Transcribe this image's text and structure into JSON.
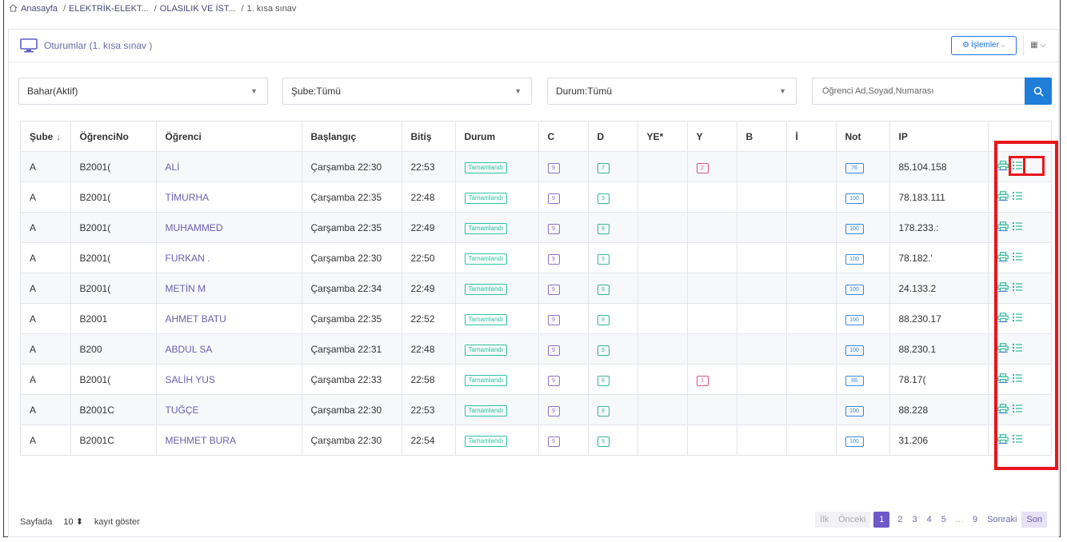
{
  "breadcrumb": {
    "home": "Anasayfa",
    "items": [
      "ELEKTRİK-ELEKT...",
      "OLASILIK VE İST...",
      "1. kısa sınav"
    ]
  },
  "header": {
    "title": "Oturumlar (1. kısa sınav )",
    "ops_label": "İşlemler"
  },
  "filters": {
    "term": "Bahar(Aktif)",
    "branch": "Şube:Tümü",
    "status": "Durum:Tümü",
    "search_placeholder": "Öğrenci Ad,Soyad,Numarası"
  },
  "table": {
    "columns": [
      "Şube",
      "ÖğrenciNo",
      "Öğrenci",
      "Başlangıç",
      "Bitiş",
      "Durum",
      "C",
      "D",
      "YE*",
      "Y",
      "B",
      "İ",
      "Not",
      "IP",
      ""
    ],
    "sort_indicator": "↓",
    "rows": [
      {
        "sube": "A",
        "no": "B2001(",
        "ogrenci": "ALİ",
        "baslangic": "Çarşamba 22:30",
        "bitis": "22:53",
        "durum": "Tamamlandı",
        "c": "9",
        "d": "7",
        "ye": "",
        "y": "2",
        "b": "",
        "i": "",
        "not": "76",
        "ip": "85.104.158"
      },
      {
        "sube": "A",
        "no": "B2001(",
        "ogrenci": "TİMURHA",
        "baslangic": "Çarşamba 22:35",
        "bitis": "22:48",
        "durum": "Tamamlandı",
        "c": "9",
        "d": "9",
        "ye": "",
        "y": "",
        "b": "",
        "i": "",
        "not": "100",
        "ip": "78.183.111"
      },
      {
        "sube": "A",
        "no": "B2001(",
        "ogrenci": "MUHAMMED",
        "baslangic": "Çarşamba 22:35",
        "bitis": "22:49",
        "durum": "Tamamlandı",
        "c": "9",
        "d": "9",
        "ye": "",
        "y": "",
        "b": "",
        "i": "",
        "not": "100",
        "ip": "178.233.:"
      },
      {
        "sube": "A",
        "no": "B2001(",
        "ogrenci": "FURKAN .",
        "baslangic": "Çarşamba 22:30",
        "bitis": "22:50",
        "durum": "Tamamlandı",
        "c": "9",
        "d": "9",
        "ye": "",
        "y": "",
        "b": "",
        "i": "",
        "not": "100",
        "ip": "78.182.'"
      },
      {
        "sube": "A",
        "no": "B2001(",
        "ogrenci": "METİN M",
        "baslangic": "Çarşamba 22:34",
        "bitis": "22:49",
        "durum": "Tamamlandı",
        "c": "9",
        "d": "9",
        "ye": "",
        "y": "",
        "b": "",
        "i": "",
        "not": "100",
        "ip": "24.133.2"
      },
      {
        "sube": "A",
        "no": "B2001",
        "ogrenci": "AHMET BATU",
        "baslangic": "Çarşamba 22:35",
        "bitis": "22:52",
        "durum": "Tamamlandı",
        "c": "9",
        "d": "9",
        "ye": "",
        "y": "",
        "b": "",
        "i": "",
        "not": "100",
        "ip": "88.230.17"
      },
      {
        "sube": "A",
        "no": "B200",
        "ogrenci": "ABDUL SA",
        "baslangic": "Çarşamba 22:31",
        "bitis": "22:48",
        "durum": "Tamamlandı",
        "c": "9",
        "d": "9",
        "ye": "",
        "y": "",
        "b": "",
        "i": "",
        "not": "100",
        "ip": "88.230.1"
      },
      {
        "sube": "A",
        "no": "B2001(",
        "ogrenci": "SALİH YUS",
        "baslangic": "Çarşamba 22:33",
        "bitis": "22:58",
        "durum": "Tamamlandı",
        "c": "9",
        "d": "8",
        "ye": "",
        "y": "1",
        "b": "",
        "i": "",
        "not": "88",
        "ip": "78.17("
      },
      {
        "sube": "A",
        "no": "B2001C",
        "ogrenci": "TUĞÇE",
        "baslangic": "Çarşamba 22:30",
        "bitis": "22:53",
        "durum": "Tamamlandı",
        "c": "9",
        "d": "9",
        "ye": "",
        "y": "",
        "b": "",
        "i": "",
        "not": "100",
        "ip": "88.228"
      },
      {
        "sube": "A",
        "no": "B2001C",
        "ogrenci": "MEHMET BURA",
        "baslangic": "Çarşamba 22:30",
        "bitis": "22:54",
        "durum": "Tamamlandı",
        "c": "9",
        "d": "9",
        "ye": "",
        "y": "",
        "b": "",
        "i": "",
        "not": "100",
        "ip": "31.206"
      }
    ]
  },
  "footer": {
    "per_page_prefix": "Sayfada",
    "per_page_value": "10",
    "per_page_suffix": "kayıt göster",
    "pager": [
      "İlk",
      "Önceki",
      "1",
      "2",
      "3",
      "4",
      "5",
      "...",
      "9",
      "Sonraki",
      "Son"
    ]
  },
  "colors": {
    "accent_blue": "#1e7ed8",
    "highlight_red": "#e8161c",
    "status_green": "#2fc3a3",
    "pager_purple": "#6e58c9"
  },
  "icons": {
    "breadcrumb": "home-icon",
    "header": "monitor-icon",
    "ops": "gear-icon",
    "search": "search-icon",
    "row_actions": [
      "print-icon",
      "list-icon"
    ]
  }
}
